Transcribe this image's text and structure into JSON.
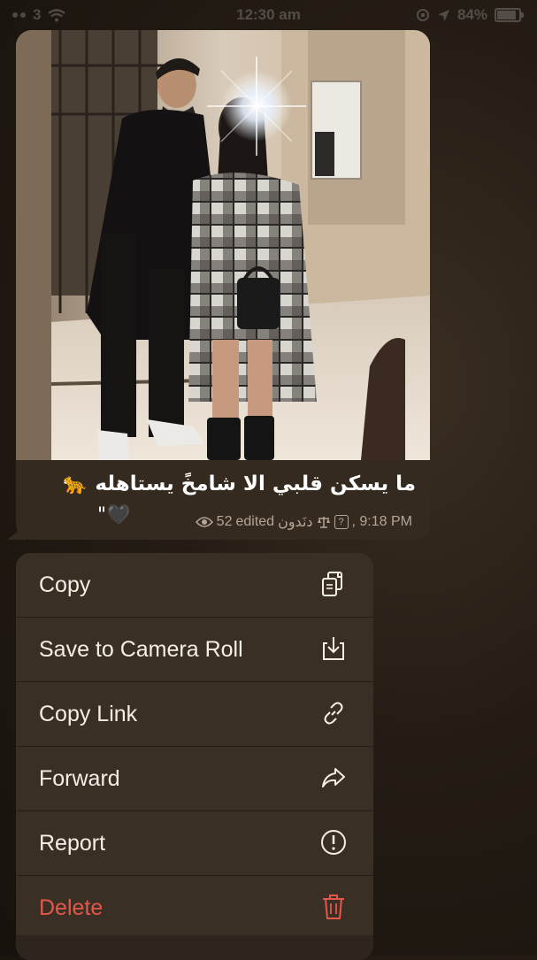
{
  "status_bar": {
    "carrier": "3",
    "time": "12:30 am",
    "battery": "84%"
  },
  "message": {
    "caption": "ما يسكن قلبي الا شامخً يستاهله 🐆",
    "caption_extra": "\"🖤",
    "views": "52",
    "edited": "edited",
    "channel": "دنَدون",
    "time": "9:18 PM"
  },
  "menu": {
    "items": [
      {
        "label": "Copy",
        "icon": "copy-icon"
      },
      {
        "label": "Save to Camera Roll",
        "icon": "save-icon"
      },
      {
        "label": "Copy Link",
        "icon": "link-icon"
      },
      {
        "label": "Forward",
        "icon": "forward-icon"
      },
      {
        "label": "Report",
        "icon": "report-icon"
      },
      {
        "label": "Delete",
        "icon": "trash-icon"
      }
    ]
  },
  "colors": {
    "background": "#241c14",
    "bubble": "#342a1f",
    "menu": "#3a2f24",
    "danger": "#e5574b",
    "meta": "#b3a797"
  }
}
